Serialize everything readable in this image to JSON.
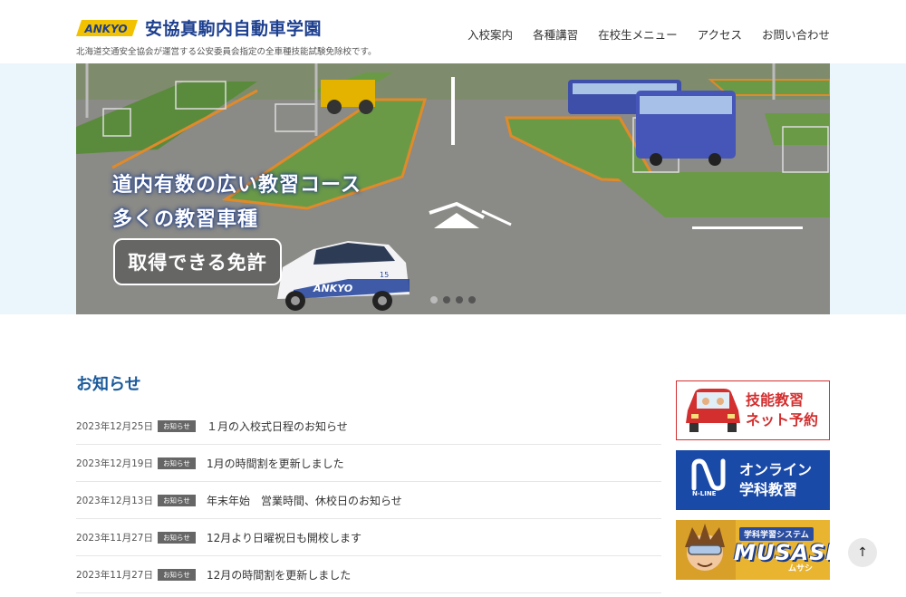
{
  "header": {
    "logo_mark": "ANKYO",
    "title": "安協真駒内自動車学園",
    "tagline": "北海道交通安全協会が運営する公安委員会指定の全車種技能試験免除校です。",
    "nav": [
      "入校案内",
      "各種講習",
      "在校生メニュー",
      "アクセス",
      "お問い合わせ"
    ]
  },
  "hero": {
    "line1": "道内有数の広い教習コース",
    "line2": "多くの教習車種",
    "button": "取得できる免許",
    "car_logo": "ANKYO",
    "car_number": "15",
    "slide_count": 4,
    "active_slide": 1
  },
  "news": {
    "title": "お知らせ",
    "items": [
      {
        "date": "2023年12月25日",
        "tag": "お知らせ",
        "text": "１月の入校式日程のお知らせ"
      },
      {
        "date": "2023年12月19日",
        "tag": "お知らせ",
        "text": "1月の時間割を更新しました"
      },
      {
        "date": "2023年12月13日",
        "tag": "お知らせ",
        "text": "年末年始　営業時間、休校日のお知らせ"
      },
      {
        "date": "2023年11月27日",
        "tag": "お知らせ",
        "text": "12月より日曜祝日も開校します"
      },
      {
        "date": "2023年11月27日",
        "tag": "お知らせ",
        "text": "12月の時間割を更新しました"
      }
    ]
  },
  "banners": {
    "reservation": {
      "line1": "技能教習",
      "line2": "ネット予約"
    },
    "online": {
      "line1": "オンライン",
      "line2": "学科教習",
      "logo_text": "N-LINE"
    },
    "musasi": {
      "system": "学科学習システム",
      "name": "MUSASI",
      "kana": "ムサシ"
    }
  },
  "icons": {
    "to_top": "arrow-up-icon"
  },
  "colors": {
    "brand": "#1d3f8f",
    "accent_red": "#d32f2f",
    "news_title": "#1a5a9a",
    "online_blue": "#1a4aa8"
  }
}
